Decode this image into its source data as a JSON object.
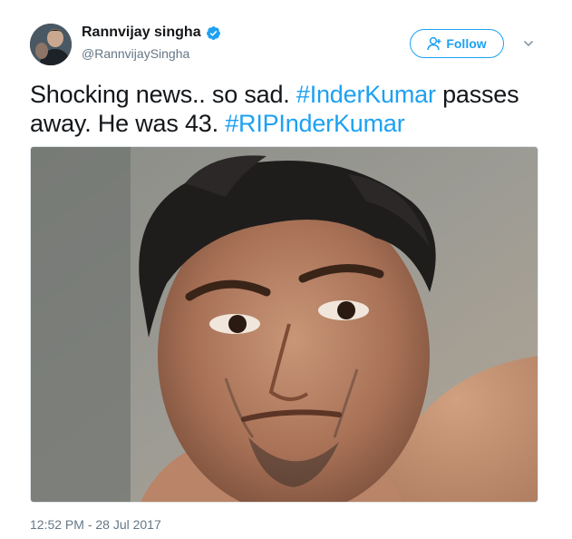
{
  "tweet": {
    "author": {
      "display_name": "Rannvijay singha",
      "handle": "@RannvijaySingha",
      "verified": true
    },
    "follow_button_label": "Follow",
    "text_parts": [
      "Shocking news.. so sad. ",
      "#InderKumar",
      " passes away. He was 43. ",
      "#RIPInderKumar"
    ],
    "timestamp": "12:52 PM - 28 Jul 2017"
  },
  "icons": {
    "verified": "verified-badge-icon",
    "follow": "add-user-icon",
    "caret": "chevron-down-icon"
  },
  "colors": {
    "accent": "#1da1f2",
    "text": "#14171a",
    "secondary_text": "#657786"
  }
}
